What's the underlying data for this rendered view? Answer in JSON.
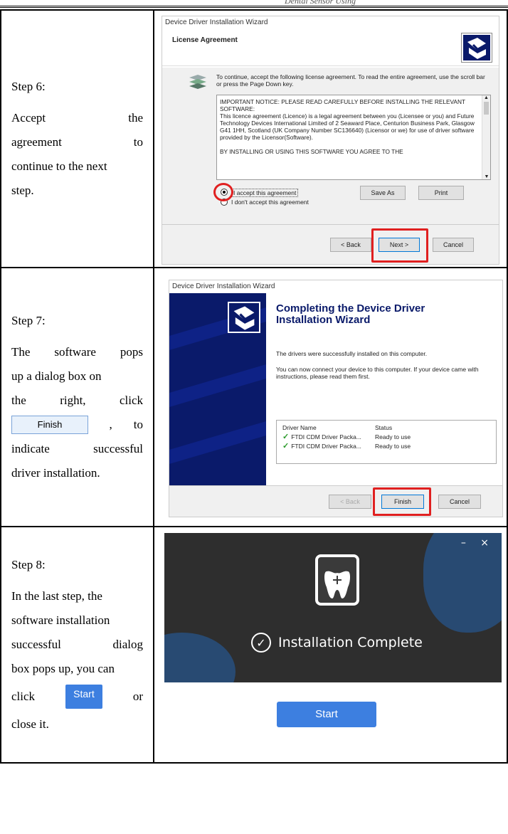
{
  "header": {
    "text": "Dental Sensor Using"
  },
  "step6": {
    "title": "Step 6:",
    "line1a": "Accept",
    "line1b": "the",
    "line2a": "agreement",
    "line2b": "to",
    "line3": "continue to the next",
    "line4": "step.",
    "dialog": {
      "window_title": "Device Driver Installation Wizard",
      "heading": "License Agreement",
      "intro": "To continue, accept the following license agreement. To read the entire agreement, use the scroll bar or press the Page Down key.",
      "license_text": "IMPORTANT NOTICE: PLEASE READ CAREFULLY BEFORE INSTALLING THE RELEVANT SOFTWARE:\nThis licence agreement (Licence) is a legal agreement between you (Licensee or you) and Future Technology Devices International Limited of 2 Seaward Place, Centurion Business Park, Glasgow G41 1HH, Scotland (UK Company Number SC136640) (Licensor or we) for use of driver software provided by the Licensor(Software).\n\nBY INSTALLING OR USING THIS SOFTWARE YOU AGREE TO THE",
      "accept": "I accept this agreement",
      "decline": "I don't accept this agreement",
      "save_as": "Save As",
      "print": "Print",
      "back": "< Back",
      "next": "Next >",
      "cancel": "Cancel"
    }
  },
  "step7": {
    "title": "Step 7:",
    "line1a": "The",
    "line1b": "software",
    "line1c": "pops",
    "line2": "up a dialog box on",
    "line3a": "the",
    "line3b": "right,",
    "line3c": "click",
    "finish_inline": "Finish",
    "line4b": ",",
    "line4c": "to",
    "line5a": "indicate",
    "line5b": "successful",
    "line6": "driver installation.",
    "dialog": {
      "window_title": "Device Driver Installation Wizard",
      "heading": "Completing the Device Driver Installation Wizard",
      "msg1": "The drivers were successfully installed on this computer.",
      "msg2": "You can now connect your device to this computer. If your device came with instructions, please read them first.",
      "col_name": "Driver Name",
      "col_status": "Status",
      "rows": [
        {
          "name": "FTDI CDM Driver Packa...",
          "status": "Ready to use"
        },
        {
          "name": "FTDI CDM Driver Packa...",
          "status": "Ready to use"
        }
      ],
      "back": "< Back",
      "finish": "Finish",
      "cancel": "Cancel"
    }
  },
  "step8": {
    "title": "Step 8:",
    "line1": "In the last step, the",
    "line2": "software installation",
    "line3a": "successful",
    "line3b": "dialog",
    "line4": "box pops up, you can",
    "line5a": "click",
    "start_inline": "Start",
    "line5b": "or",
    "line6": "close it.",
    "app": {
      "controls": "– ×",
      "complete": "Installation Complete",
      "start": "Start"
    }
  },
  "colors": {
    "red_highlight": "#e02020",
    "start_blue": "#3d7fe0",
    "wizard_navy": "#0a1a6a",
    "app_dark": "#2e2e2e"
  }
}
